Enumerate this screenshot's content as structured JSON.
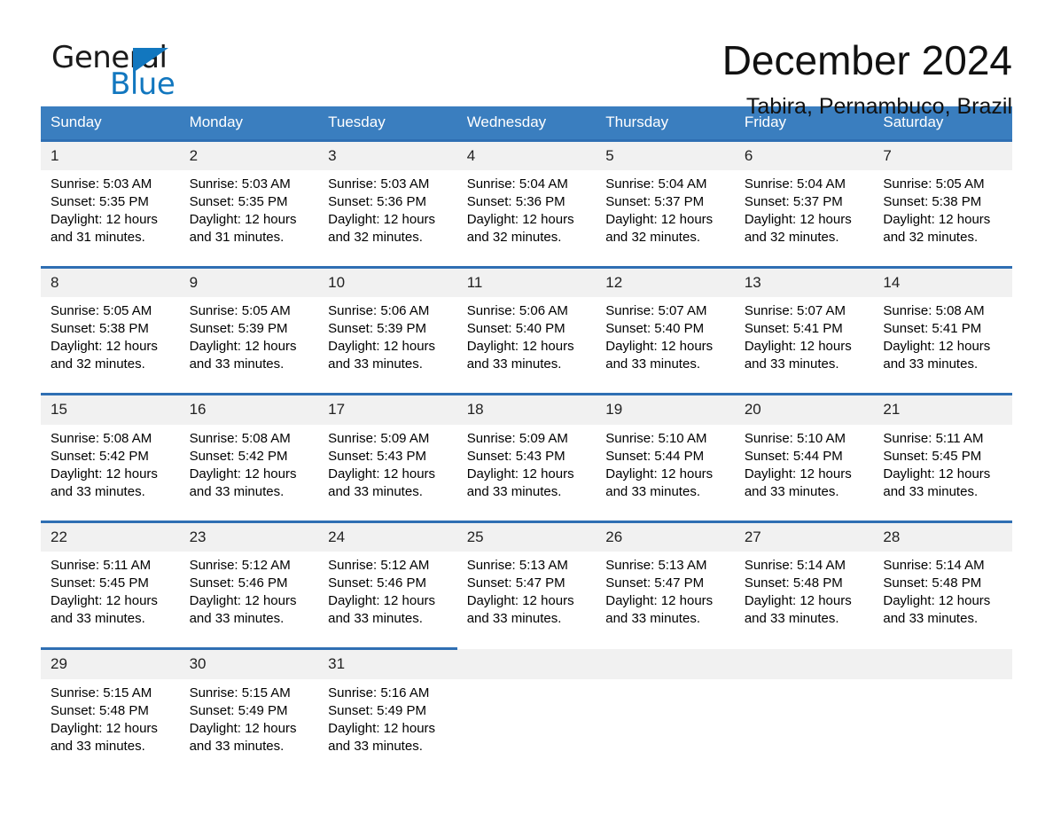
{
  "brand": {
    "name_part1": "General",
    "name_part2": "Blue",
    "accent_color": "#1277bf"
  },
  "header": {
    "month_title": "December 2024",
    "location": "Tabira, Pernambuco, Brazil"
  },
  "calendar": {
    "header_bg": "#3a7ebf",
    "row_border_color": "#2f6fb3",
    "daynum_bg": "#f1f1f1",
    "weekday_names": [
      "Sunday",
      "Monday",
      "Tuesday",
      "Wednesday",
      "Thursday",
      "Friday",
      "Saturday"
    ],
    "weeks": [
      [
        {
          "day": "1",
          "sunrise": "Sunrise: 5:03 AM",
          "sunset": "Sunset: 5:35 PM",
          "daylight": "Daylight: 12 hours and 31 minutes."
        },
        {
          "day": "2",
          "sunrise": "Sunrise: 5:03 AM",
          "sunset": "Sunset: 5:35 PM",
          "daylight": "Daylight: 12 hours and 31 minutes."
        },
        {
          "day": "3",
          "sunrise": "Sunrise: 5:03 AM",
          "sunset": "Sunset: 5:36 PM",
          "daylight": "Daylight: 12 hours and 32 minutes."
        },
        {
          "day": "4",
          "sunrise": "Sunrise: 5:04 AM",
          "sunset": "Sunset: 5:36 PM",
          "daylight": "Daylight: 12 hours and 32 minutes."
        },
        {
          "day": "5",
          "sunrise": "Sunrise: 5:04 AM",
          "sunset": "Sunset: 5:37 PM",
          "daylight": "Daylight: 12 hours and 32 minutes."
        },
        {
          "day": "6",
          "sunrise": "Sunrise: 5:04 AM",
          "sunset": "Sunset: 5:37 PM",
          "daylight": "Daylight: 12 hours and 32 minutes."
        },
        {
          "day": "7",
          "sunrise": "Sunrise: 5:05 AM",
          "sunset": "Sunset: 5:38 PM",
          "daylight": "Daylight: 12 hours and 32 minutes."
        }
      ],
      [
        {
          "day": "8",
          "sunrise": "Sunrise: 5:05 AM",
          "sunset": "Sunset: 5:38 PM",
          "daylight": "Daylight: 12 hours and 32 minutes."
        },
        {
          "day": "9",
          "sunrise": "Sunrise: 5:05 AM",
          "sunset": "Sunset: 5:39 PM",
          "daylight": "Daylight: 12 hours and 33 minutes."
        },
        {
          "day": "10",
          "sunrise": "Sunrise: 5:06 AM",
          "sunset": "Sunset: 5:39 PM",
          "daylight": "Daylight: 12 hours and 33 minutes."
        },
        {
          "day": "11",
          "sunrise": "Sunrise: 5:06 AM",
          "sunset": "Sunset: 5:40 PM",
          "daylight": "Daylight: 12 hours and 33 minutes."
        },
        {
          "day": "12",
          "sunrise": "Sunrise: 5:07 AM",
          "sunset": "Sunset: 5:40 PM",
          "daylight": "Daylight: 12 hours and 33 minutes."
        },
        {
          "day": "13",
          "sunrise": "Sunrise: 5:07 AM",
          "sunset": "Sunset: 5:41 PM",
          "daylight": "Daylight: 12 hours and 33 minutes."
        },
        {
          "day": "14",
          "sunrise": "Sunrise: 5:08 AM",
          "sunset": "Sunset: 5:41 PM",
          "daylight": "Daylight: 12 hours and 33 minutes."
        }
      ],
      [
        {
          "day": "15",
          "sunrise": "Sunrise: 5:08 AM",
          "sunset": "Sunset: 5:42 PM",
          "daylight": "Daylight: 12 hours and 33 minutes."
        },
        {
          "day": "16",
          "sunrise": "Sunrise: 5:08 AM",
          "sunset": "Sunset: 5:42 PM",
          "daylight": "Daylight: 12 hours and 33 minutes."
        },
        {
          "day": "17",
          "sunrise": "Sunrise: 5:09 AM",
          "sunset": "Sunset: 5:43 PM",
          "daylight": "Daylight: 12 hours and 33 minutes."
        },
        {
          "day": "18",
          "sunrise": "Sunrise: 5:09 AM",
          "sunset": "Sunset: 5:43 PM",
          "daylight": "Daylight: 12 hours and 33 minutes."
        },
        {
          "day": "19",
          "sunrise": "Sunrise: 5:10 AM",
          "sunset": "Sunset: 5:44 PM",
          "daylight": "Daylight: 12 hours and 33 minutes."
        },
        {
          "day": "20",
          "sunrise": "Sunrise: 5:10 AM",
          "sunset": "Sunset: 5:44 PM",
          "daylight": "Daylight: 12 hours and 33 minutes."
        },
        {
          "day": "21",
          "sunrise": "Sunrise: 5:11 AM",
          "sunset": "Sunset: 5:45 PM",
          "daylight": "Daylight: 12 hours and 33 minutes."
        }
      ],
      [
        {
          "day": "22",
          "sunrise": "Sunrise: 5:11 AM",
          "sunset": "Sunset: 5:45 PM",
          "daylight": "Daylight: 12 hours and 33 minutes."
        },
        {
          "day": "23",
          "sunrise": "Sunrise: 5:12 AM",
          "sunset": "Sunset: 5:46 PM",
          "daylight": "Daylight: 12 hours and 33 minutes."
        },
        {
          "day": "24",
          "sunrise": "Sunrise: 5:12 AM",
          "sunset": "Sunset: 5:46 PM",
          "daylight": "Daylight: 12 hours and 33 minutes."
        },
        {
          "day": "25",
          "sunrise": "Sunrise: 5:13 AM",
          "sunset": "Sunset: 5:47 PM",
          "daylight": "Daylight: 12 hours and 33 minutes."
        },
        {
          "day": "26",
          "sunrise": "Sunrise: 5:13 AM",
          "sunset": "Sunset: 5:47 PM",
          "daylight": "Daylight: 12 hours and 33 minutes."
        },
        {
          "day": "27",
          "sunrise": "Sunrise: 5:14 AM",
          "sunset": "Sunset: 5:48 PM",
          "daylight": "Daylight: 12 hours and 33 minutes."
        },
        {
          "day": "28",
          "sunrise": "Sunrise: 5:14 AM",
          "sunset": "Sunset: 5:48 PM",
          "daylight": "Daylight: 12 hours and 33 minutes."
        }
      ],
      [
        {
          "day": "29",
          "sunrise": "Sunrise: 5:15 AM",
          "sunset": "Sunset: 5:48 PM",
          "daylight": "Daylight: 12 hours and 33 minutes."
        },
        {
          "day": "30",
          "sunrise": "Sunrise: 5:15 AM",
          "sunset": "Sunset: 5:49 PM",
          "daylight": "Daylight: 12 hours and 33 minutes."
        },
        {
          "day": "31",
          "sunrise": "Sunrise: 5:16 AM",
          "sunset": "Sunset: 5:49 PM",
          "daylight": "Daylight: 12 hours and 33 minutes."
        },
        {
          "day": "",
          "sunrise": "",
          "sunset": "",
          "daylight": ""
        },
        {
          "day": "",
          "sunrise": "",
          "sunset": "",
          "daylight": ""
        },
        {
          "day": "",
          "sunrise": "",
          "sunset": "",
          "daylight": ""
        },
        {
          "day": "",
          "sunrise": "",
          "sunset": "",
          "daylight": ""
        }
      ]
    ]
  }
}
